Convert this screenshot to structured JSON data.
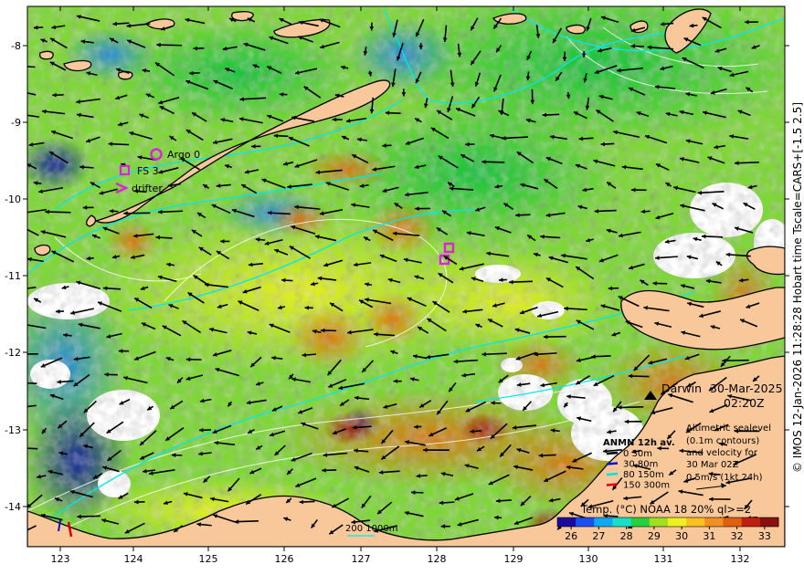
{
  "map": {
    "axes": {
      "lon_ticks": [
        "123",
        "124",
        "125",
        "126",
        "127",
        "128",
        "129",
        "130",
        "131",
        "132"
      ],
      "lat_ticks": [
        "-8",
        "-9",
        "-10",
        "-11",
        "-12",
        "-13",
        "-14"
      ]
    },
    "side_label": "© IMOS 12-Jan-2026 11:28:28 Hobart time Tscale=CARS+[-1.5 2.5]",
    "legend_markers": [
      {
        "label": "Argo 0",
        "marker": "circle"
      },
      {
        "label": "FS 3",
        "marker": "square"
      },
      {
        "label": "drifter",
        "marker": "chevron"
      }
    ],
    "place": {
      "name": "Darwin",
      "date": "30-Mar-2025",
      "time": "02:20Z"
    },
    "velocity_legend": {
      "title": "ANMN 12h av.",
      "items": [
        {
          "label": "0 30m",
          "color": "#000000"
        },
        {
          "label": "30 80m",
          "color": "#1010d0"
        },
        {
          "label": "80 150m",
          "color": "#00e0e0"
        },
        {
          "label": "150 300m",
          "color": "#e00000"
        }
      ]
    },
    "altimetry_note": [
      "Altimetric sealevel",
      "(0.1m contours)",
      "and velocity for",
      "30 Mar 02Z",
      "0.5m/s (1kt 24h)"
    ],
    "depth_label": "200  1000m",
    "colorbar": {
      "title": "Temp. (°C) NOAA 18 20% ql>=2",
      "ticks": [
        "26",
        "27",
        "28",
        "29",
        "30",
        "31",
        "32",
        "33"
      ],
      "min": 25.5,
      "max": 33.5,
      "colors": [
        "#1a0a9e",
        "#1a4ff0",
        "#10a8f0",
        "#18e0c8",
        "#28d040",
        "#a0e020",
        "#f0f020",
        "#f8c020",
        "#f09020",
        "#e06010",
        "#c02010",
        "#8a1010"
      ]
    },
    "colors": {
      "land": "#f9c89a",
      "mooring": "#e020e0",
      "contour": "#00e8f0"
    }
  }
}
